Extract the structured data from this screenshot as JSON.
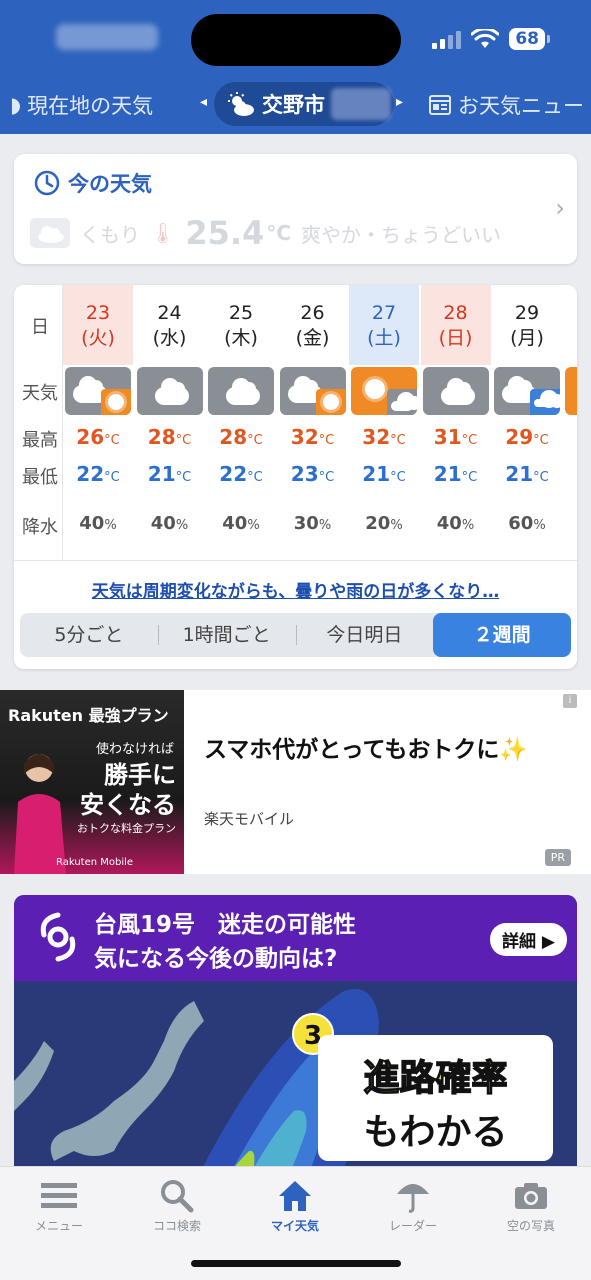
{
  "status": {
    "battery": "68"
  },
  "header": {
    "left_tab": "現在地の天気",
    "center_tab": "交野市",
    "right_tab": "お天気ニュー"
  },
  "now": {
    "title": "今の天気",
    "condition": "くもり",
    "temp": "25.4",
    "temp_unit": "°C",
    "comfort": "爽やか・ちょうどいい"
  },
  "forecast": {
    "row_labels": {
      "day": "日",
      "weather": "天気",
      "high": "最高",
      "low": "最低",
      "rain": "降水"
    },
    "temp_unit": "°C",
    "rain_unit": "%",
    "days": [
      {
        "date": "23",
        "dow": "(火)",
        "style": "holiday",
        "icon": "cloud-sun",
        "high": "26",
        "low": "22",
        "rain": "40"
      },
      {
        "date": "24",
        "dow": "(水)",
        "style": "normal",
        "icon": "cloud",
        "high": "28",
        "low": "21",
        "rain": "40"
      },
      {
        "date": "25",
        "dow": "(木)",
        "style": "normal",
        "icon": "cloud",
        "high": "28",
        "low": "22",
        "rain": "40"
      },
      {
        "date": "26",
        "dow": "(金)",
        "style": "normal",
        "icon": "cloud-sun",
        "high": "32",
        "low": "23",
        "rain": "30"
      },
      {
        "date": "27",
        "dow": "(土)",
        "style": "sat",
        "icon": "sun-cloud",
        "high": "32",
        "low": "21",
        "rain": "20"
      },
      {
        "date": "28",
        "dow": "(日)",
        "style": "sun",
        "icon": "cloud",
        "high": "31",
        "low": "21",
        "rain": "40"
      },
      {
        "date": "29",
        "dow": "(月)",
        "style": "normal",
        "icon": "cloud-rain",
        "high": "29",
        "low": "21",
        "rain": "60"
      }
    ],
    "summary_link": "天気は周期変化ながらも、曇りや雨の日が多くなり…",
    "segments": [
      "5分ごと",
      "1時間ごと",
      "今日明日",
      "２週間"
    ],
    "active_segment": 3
  },
  "ad": {
    "brand": "Rakuten 最強プラン",
    "line1": "使わなければ",
    "big": "勝手に\n安くなる",
    "small": "おトクな料金プラン",
    "rm": "Rakuten Mobile",
    "headline": "スマホ代がとってもおトクに✨",
    "advertiser": "楽天モバイル",
    "info": "i",
    "pr": "PR"
  },
  "typhoon": {
    "line1": "台風19号　迷走の可能性",
    "line2": "気になる今後の動向は?",
    "detail": "詳細",
    "badge": "3",
    "bubble1": "進路確率",
    "bubble2": "もわかる"
  },
  "nav": {
    "items": [
      "メニュー",
      "ココ検索",
      "マイ天気",
      "レーダー",
      "空の写真"
    ],
    "active": 2
  },
  "colors": {
    "primary": "#2d63be",
    "orange": "#f08a24",
    "high": "#e0571f",
    "low": "#2d6fd0"
  }
}
